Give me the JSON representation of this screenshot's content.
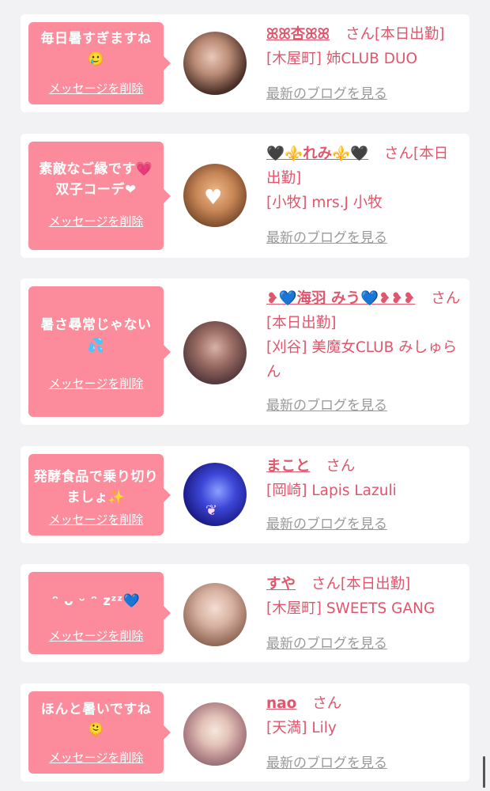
{
  "colors": {
    "background": "#f2f2f4",
    "card": "#ffffff",
    "bubble": "#fc8c9c",
    "name_text": "#e0566c",
    "blog_link": "#9a9a9a"
  },
  "entries": [
    {
      "message": "毎日暑すぎますね🥲",
      "delete_label": "メッセージを削除",
      "name": "ꕤꕤ杏ꕤꕤ",
      "suffix": "さん",
      "badge": "[本日出勤]",
      "shop": "[木屋町] 姉CLUB DUO",
      "blog_label": "最新のブログを見る"
    },
    {
      "message": "素敵なご縁です💗双子コーデ❤",
      "delete_label": "メッセージを削除",
      "name": "🖤⚜️れみ⚜️🖤",
      "suffix": "さん",
      "badge": "[本日出勤]",
      "shop": "[小牧] mrs.J 小牧",
      "blog_label": "最新のブログを見る"
    },
    {
      "message": "暑さ尋常じゃない💦",
      "delete_label": "メッセージを削除",
      "name": "❥💙海羽 みう💙❥❥❥",
      "suffix": "さん",
      "badge": "[本日出勤]",
      "shop": "[刈谷] 美魔女CLUB みしゅらん",
      "blog_label": "最新のブログを見る"
    },
    {
      "message": "発酵食品で乗り切りましょ✨",
      "delete_label": "メッセージを削除",
      "name": "まこと",
      "suffix": "さん",
      "badge": "",
      "shop": "[岡崎] Lapis Lazuli",
      "blog_label": "最新のブログを見る"
    },
    {
      "message": "ᵔ ᴗ ᵕ ᵔ zᶻᶻ💙",
      "delete_label": "メッセージを削除",
      "name": "すや",
      "suffix": "さん",
      "badge": "[本日出勤]",
      "shop": "[木屋町] SWEETS GANG",
      "blog_label": "最新のブログを見る"
    },
    {
      "message": "ほんと暑いですね🫠",
      "delete_label": "メッセージを削除",
      "name": "nao",
      "suffix": "さん",
      "badge": "",
      "shop": "[天満] Lily",
      "blog_label": "最新のブログを見る"
    }
  ]
}
